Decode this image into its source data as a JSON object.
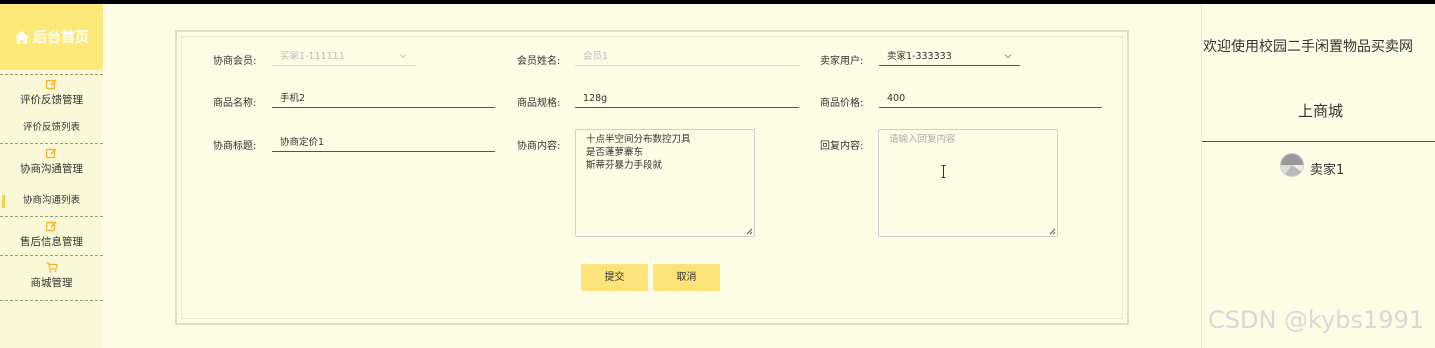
{
  "sidebar": {
    "home": "后台首页",
    "sections": [
      {
        "label": "评价反馈管理",
        "items": [
          "评价反馈列表"
        ]
      },
      {
        "label": "协商沟通管理",
        "items": [
          "协商沟通列表"
        ]
      },
      {
        "label": "售后信息管理",
        "items": []
      },
      {
        "label": "商城管理",
        "items": []
      }
    ],
    "active_item": "协商沟通列表"
  },
  "form": {
    "member_label": "协商会员:",
    "member_value": "买家1-111111",
    "member_name_label": "会员姓名:",
    "member_name_value": "会员1",
    "seller_label": "卖家用户:",
    "seller_value": "卖家1-333333",
    "product_name_label": "商品名称:",
    "product_name_value": "手机2",
    "product_spec_label": "商品规格:",
    "product_spec_value": "128g",
    "product_price_label": "商品价格:",
    "product_price_value": "400",
    "title_label": "协商标题:",
    "title_value": "协商定价1",
    "content_label": "协商内容:",
    "content_lines": [
      "十点半空间分布数控刀具",
      "是否蓬萝寨东",
      "斯蒂芬暴力手段就"
    ],
    "reply_label": "回复内容:",
    "reply_placeholder": "请输入回复内容",
    "submit_label": "提交",
    "cancel_label": "取消"
  },
  "right_panel": {
    "welcome": "欢迎使用校园二手闲置物品买卖网",
    "store_link": "上商城",
    "username": "卖家1"
  },
  "watermark": "CSDN @kybs1991",
  "colors": {
    "background": "#fdfde6",
    "sidebar_bg": "#fbf8d8",
    "accent_yellow": "#fde97a",
    "button_yellow": "#fde37a",
    "icon_orange": "#f2b632"
  },
  "icons": [
    "home-icon",
    "edit-icon",
    "cart-icon",
    "chevron-down-icon",
    "text-cursor-icon",
    "avatar-icon"
  ]
}
